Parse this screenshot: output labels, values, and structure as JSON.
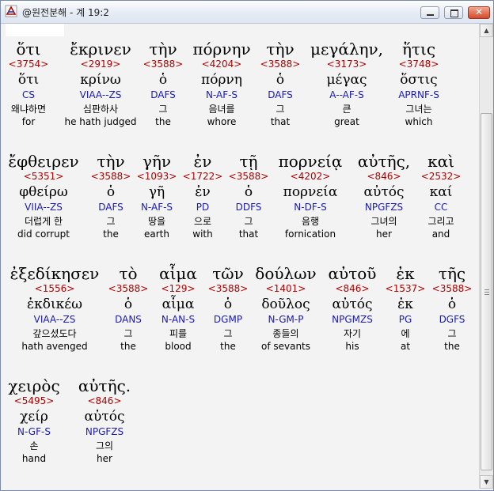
{
  "window": {
    "title": "@원전분해 - 계 19:2",
    "minimize_icon": "minimize-icon",
    "maximize_icon": "maximize-icon",
    "close_icon": "close-icon",
    "close_glyph": "✕"
  },
  "rows": [
    {
      "words": [
        {
          "greek": "ὅτι",
          "strong": "<3754>",
          "lemma": "ὅτι",
          "parse": "CS",
          "korean": "왜냐하면",
          "english": "for"
        },
        {
          "greek": "ἔκρινεν",
          "strong": "<2919>",
          "lemma": "κρίνω",
          "parse": "VIAA--ZS",
          "korean": "심판하사",
          "english": "he hath judged"
        },
        {
          "greek": "τὴν",
          "strong": "<3588>",
          "lemma": "ὁ",
          "parse": "DAFS",
          "korean": "그",
          "english": "the"
        },
        {
          "greek": "πόρνην",
          "strong": "<4204>",
          "lemma": "πόρνη",
          "parse": "N-AF-S",
          "korean": "음녀를",
          "english": "whore"
        },
        {
          "greek": "τὴν",
          "strong": "<3588>",
          "lemma": "ὁ",
          "parse": "DAFS",
          "korean": "그",
          "english": "that"
        },
        {
          "greek": "μεγάλην,",
          "strong": "<3173>",
          "lemma": "μέγας",
          "parse": "A--AF-S",
          "korean": "큰",
          "english": "great"
        },
        {
          "greek": "ἥτις",
          "strong": "<3748>",
          "lemma": "ὅστις",
          "parse": "APRNF-S",
          "korean": "그녀는",
          "english": "which"
        }
      ]
    },
    {
      "words": [
        {
          "greek": "ἔφθειρεν",
          "strong": "<5351>",
          "lemma": "φθείρω",
          "parse": "VIIA--ZS",
          "korean": "더럽게 한",
          "english": "did corrupt"
        },
        {
          "greek": "τὴν",
          "strong": "<3588>",
          "lemma": "ὁ",
          "parse": "DAFS",
          "korean": "그",
          "english": "the"
        },
        {
          "greek": "γῆν",
          "strong": "<1093>",
          "lemma": "γῆ",
          "parse": "N-AF-S",
          "korean": "땅을",
          "english": "earth"
        },
        {
          "greek": "ἐν",
          "strong": "<1722>",
          "lemma": "ἐν",
          "parse": "PD",
          "korean": "으로",
          "english": "with"
        },
        {
          "greek": "τῇ",
          "strong": "<3588>",
          "lemma": "ὁ",
          "parse": "DDFS",
          "korean": "그",
          "english": "that"
        },
        {
          "greek": "πορνείᾳ",
          "strong": "<4202>",
          "lemma": "πορνεία",
          "parse": "N-DF-S",
          "korean": "음행",
          "english": "fornication"
        },
        {
          "greek": "αὐτῆς,",
          "strong": "<846>",
          "lemma": "αὐτός",
          "parse": "NPGFZS",
          "korean": "그녀의",
          "english": "her"
        },
        {
          "greek": "καὶ",
          "strong": "<2532>",
          "lemma": "καί",
          "parse": "CC",
          "korean": "그리고",
          "english": "and"
        }
      ]
    },
    {
      "words": [
        {
          "greek": "ἐξεδίκησεν",
          "strong": "<1556>",
          "lemma": "ἐκδικέω",
          "parse": "VIAA--ZS",
          "korean": "갚으셨도다",
          "english": "hath avenged"
        },
        {
          "greek": "τὸ",
          "strong": "<3588>",
          "lemma": "ὁ",
          "parse": "DANS",
          "korean": "그",
          "english": "the"
        },
        {
          "greek": "αἷμα",
          "strong": "<129>",
          "lemma": "αἷμα",
          "parse": "N-AN-S",
          "korean": "피를",
          "english": "blood"
        },
        {
          "greek": "τῶν",
          "strong": "<3588>",
          "lemma": "ὁ",
          "parse": "DGMP",
          "korean": "그",
          "english": "the"
        },
        {
          "greek": "δούλων",
          "strong": "<1401>",
          "lemma": "δοῦλος",
          "parse": "N-GM-P",
          "korean": "종들의",
          "english": "of sevants"
        },
        {
          "greek": "αὐτοῦ",
          "strong": "<846>",
          "lemma": "αὐτός",
          "parse": "NPGMZS",
          "korean": "자기",
          "english": "his"
        },
        {
          "greek": "ἐκ",
          "strong": "<1537>",
          "lemma": "ἐκ",
          "parse": "PG",
          "korean": "에",
          "english": "at"
        },
        {
          "greek": "τῆς",
          "strong": "<3588>",
          "lemma": "ὁ",
          "parse": "DGFS",
          "korean": "그",
          "english": "the"
        }
      ]
    },
    {
      "words": [
        {
          "greek": "χειρὸς",
          "strong": "<5495>",
          "lemma": "χείρ",
          "parse": "N-GF-S",
          "korean": "손",
          "english": "hand"
        },
        {
          "greek": "αὐτῆς.",
          "strong": "<846>",
          "lemma": "αὐτός",
          "parse": "NPGFZS",
          "korean": "그의",
          "english": "her"
        }
      ]
    }
  ],
  "scrollbar": {
    "up_glyph": "▲",
    "down_glyph": "▼"
  }
}
